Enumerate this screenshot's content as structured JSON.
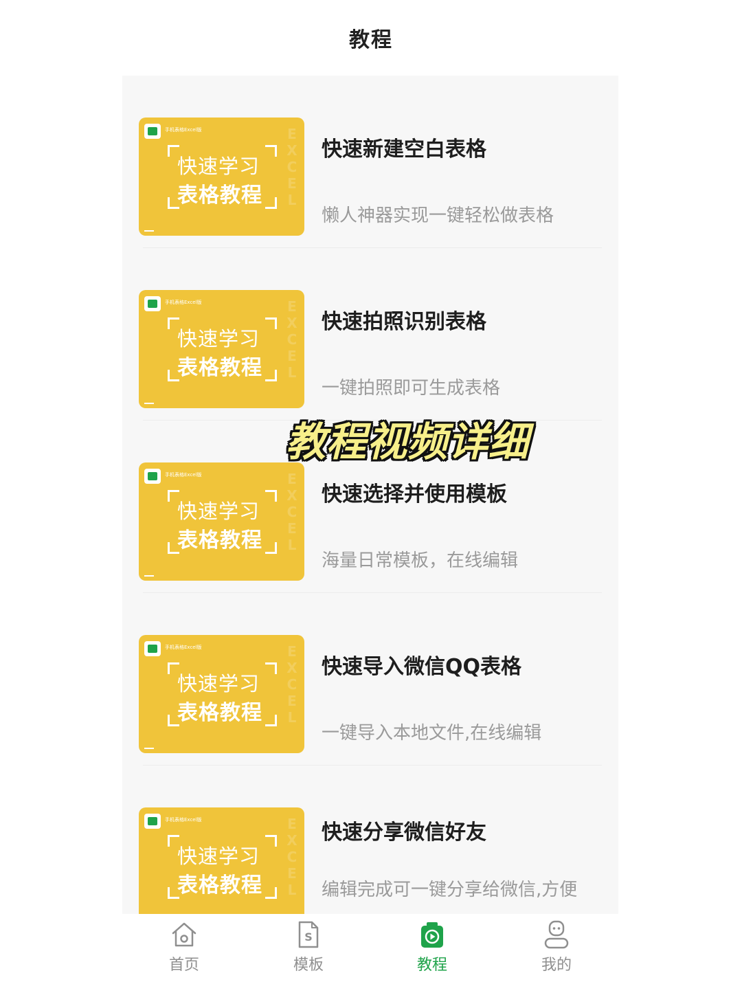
{
  "header": {
    "title": "教程"
  },
  "overlay_caption": "教程视频详细",
  "thumbnail": {
    "brand": "手机表格Excel版",
    "line1": "快速学习",
    "line2": "表格教程",
    "side_text": "EXCEL"
  },
  "tutorials": [
    {
      "title": "快速新建空白表格",
      "desc": "懒人神器实现一键轻松做表格"
    },
    {
      "title": "快速拍照识别表格",
      "desc": "一键拍照即可生成表格"
    },
    {
      "title": "快速选择并使用模板",
      "desc": "海量日常模板，在线编辑"
    },
    {
      "title": "快速导入微信QQ表格",
      "desc": "一键导入本地文件,在线编辑"
    },
    {
      "title": "快速分享微信好友",
      "desc": "编辑完成可一键分享给微信,方便"
    }
  ],
  "tabbar": {
    "items": [
      {
        "label": "首页",
        "icon": "home-icon"
      },
      {
        "label": "模板",
        "icon": "template-icon"
      },
      {
        "label": "教程",
        "icon": "tutorial-icon"
      },
      {
        "label": "我的",
        "icon": "profile-icon"
      }
    ],
    "active_index": 2
  },
  "colors": {
    "accent": "#1fa34a",
    "thumbnail_bg": "#f0c43a",
    "panel_bg": "#f7f7f7"
  }
}
